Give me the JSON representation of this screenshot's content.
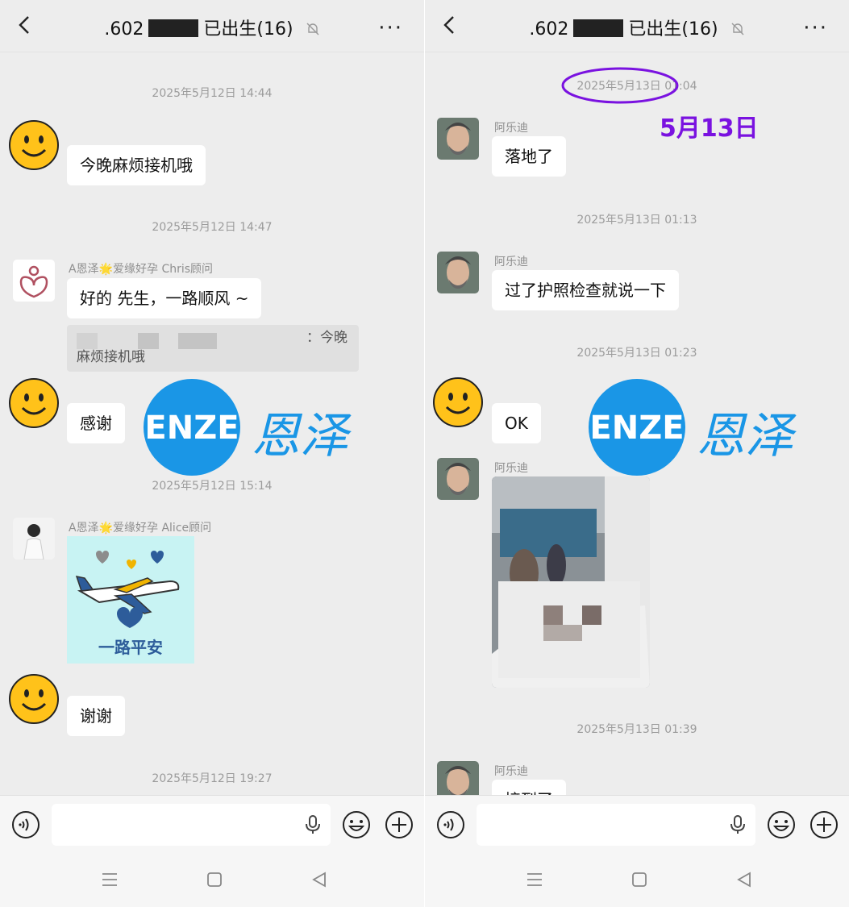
{
  "left": {
    "header": {
      "title_prefix": ".602",
      "title_suffix": "已出生(16)"
    },
    "timestamps": [
      "2025年5月12日 14:44",
      "2025年5月12日 14:47",
      "2025年5月12日 15:14",
      "2025年5月12日 19:27"
    ],
    "messages": {
      "m1": "今晚麻烦接机哦",
      "chris_name": "A恩泽🌟爱缘好孕 Chris顾问",
      "chris_reply": "好的 先生，一路顺风 ~",
      "quote_line1": "：今晚",
      "quote_line2": "麻烦接机哦",
      "m2": "感谢",
      "alice_name": "A恩泽🌟爱缘好孕 Alice顾问",
      "sticker_text": "一路平安",
      "m3": "谢谢"
    }
  },
  "right": {
    "header": {
      "title_prefix": ".602",
      "title_suffix": "已出生(16)"
    },
    "timestamps": [
      "2025年5月13日 01:04",
      "2025年5月13日 01:13",
      "2025年5月13日 01:23",
      "2025年5月13日 01:39"
    ],
    "annotation": "5月13日",
    "sender_name": "阿乐迪",
    "messages": {
      "r1": "落地了",
      "r2": "过了护照检查就说一下",
      "r3": "OK",
      "r4_partial": "接到了"
    }
  },
  "watermark": {
    "latin": "ENZE",
    "chinese": "恩泽",
    "color": "#1a96e6"
  },
  "colors": {
    "bg": "#ededed",
    "bubble": "#ffffff",
    "annotation": "#7a12e0"
  }
}
